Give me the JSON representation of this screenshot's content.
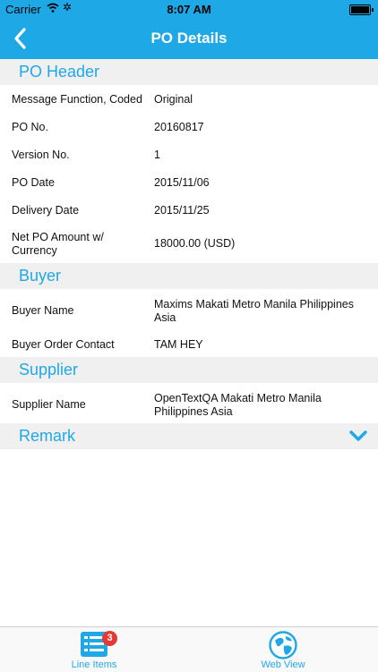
{
  "status_bar": {
    "carrier": "Carrier",
    "time": "8:07 AM"
  },
  "nav": {
    "title": "PO Details",
    "back_icon": "chevron-left-icon"
  },
  "sections": {
    "header": {
      "title": "PO Header",
      "rows": [
        {
          "label": "Message Function, Coded",
          "value": "Original"
        },
        {
          "label": "PO No.",
          "value": "20160817"
        },
        {
          "label": "Version No.",
          "value": "1"
        },
        {
          "label": "PO Date",
          "value": "2015/11/06"
        },
        {
          "label": "Delivery Date",
          "value": "2015/11/25"
        },
        {
          "label_line1": "Net PO Amount w/",
          "label_line2": "Currency",
          "value": "18000.00 (USD)"
        }
      ]
    },
    "buyer": {
      "title": "Buyer",
      "rows": [
        {
          "label": "Buyer Name",
          "value_line1": "Maxims Makati Metro Manila Philippines",
          "value_line2": "Asia"
        },
        {
          "label": "Buyer Order Contact",
          "value": "TAM HEY"
        }
      ]
    },
    "supplier": {
      "title": "Supplier",
      "rows": [
        {
          "label": "Supplier Name",
          "value_line1": "OpenTextQA Makati Metro Manila",
          "value_line2": "Philippines Asia"
        }
      ]
    },
    "remark": {
      "title": "Remark",
      "expand_icon": "chevron-down-icon"
    }
  },
  "tabbar": {
    "tabs": [
      {
        "label": "Line Items",
        "icon": "list-icon",
        "badge": "3"
      },
      {
        "label": "Web View",
        "icon": "globe-icon"
      }
    ]
  },
  "colors": {
    "accent": "#1fa8e6",
    "section_bg": "#f0f0f0",
    "badge": "#e53935"
  }
}
